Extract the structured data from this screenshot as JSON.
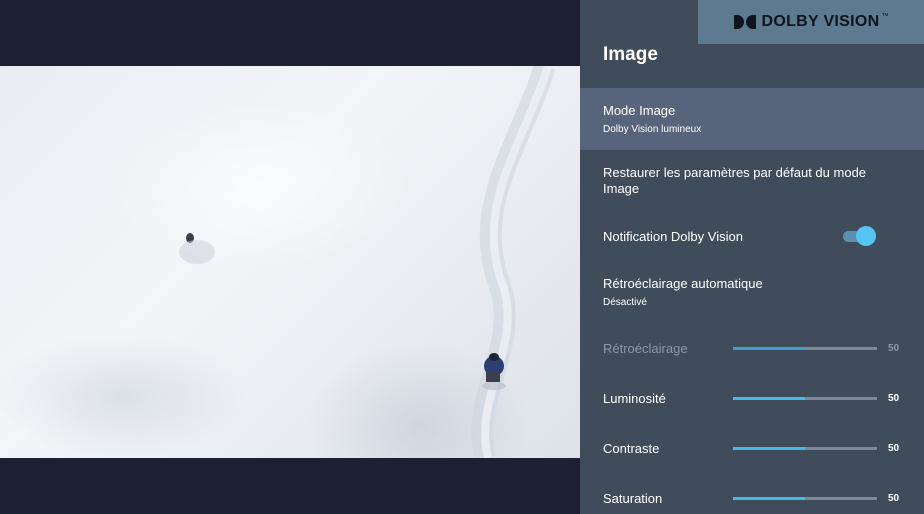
{
  "brand": {
    "name": "DOLBY VISION",
    "trademark": "™"
  },
  "panel": {
    "title": "Image",
    "items": [
      {
        "label": "Mode Image",
        "value": "Dolby Vision lumineux"
      },
      {
        "label": "Restaurer les paramètres par défaut du mode Image"
      },
      {
        "label": "Notification Dolby Vision",
        "toggle_on": true
      },
      {
        "label": "Rétroéclairage automatique",
        "value": "Désactivé"
      }
    ],
    "sliders": [
      {
        "label": "Rétroéclairage",
        "value": 50,
        "value_text": "50",
        "enabled": false
      },
      {
        "label": "Luminosité",
        "value": 50,
        "value_text": "50",
        "enabled": true
      },
      {
        "label": "Contraste",
        "value": 50,
        "value_text": "50",
        "enabled": true
      },
      {
        "label": "Saturation",
        "value": 50,
        "value_text": "50",
        "enabled": true
      }
    ]
  },
  "colors": {
    "panel_bg": "#414c5b",
    "highlight": "#58637c",
    "accent": "#43b9ee",
    "brand_bg": "#5e7a8f"
  }
}
